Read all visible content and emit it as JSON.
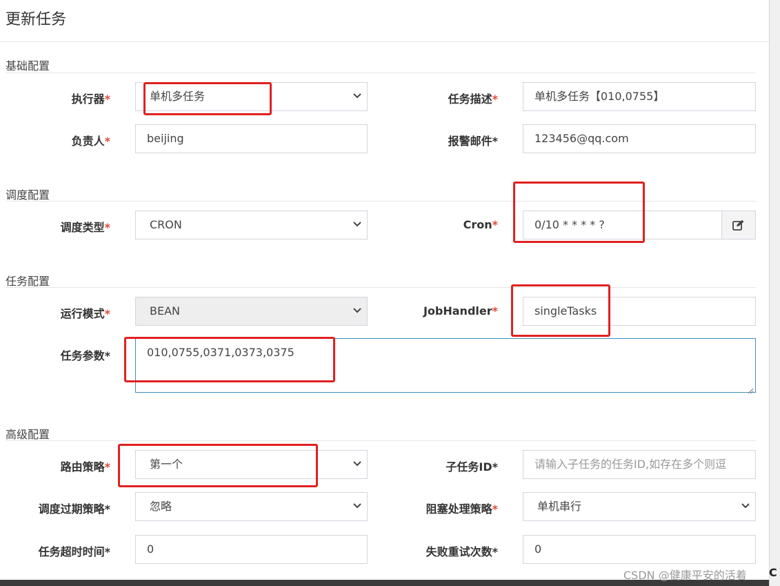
{
  "modal": {
    "title": "更新任务"
  },
  "sections": {
    "basic": "基础配置",
    "schedule": "调度配置",
    "task": "任务配置",
    "advanced": "高级配置"
  },
  "fields": {
    "executor": {
      "label": "执行器",
      "required_mark": "*",
      "value": "单机多任务"
    },
    "job_desc": {
      "label": "任务描述",
      "required_mark": "*",
      "value": "单机多任务【010,0755】"
    },
    "author": {
      "label": "负责人",
      "required_mark": "*",
      "value": "beijing"
    },
    "alarm_email": {
      "label": "报警邮件",
      "required_mark": "*",
      "value": "123456@qq.com"
    },
    "schedule_type": {
      "label": "调度类型",
      "required_mark": "*",
      "value": "CRON"
    },
    "cron": {
      "label": "Cron",
      "required_mark": "*",
      "value": "0/10 * * * * ?",
      "button_icon": "edit-icon"
    },
    "glue_type": {
      "label": "运行模式",
      "required_mark": "*",
      "value": "BEAN"
    },
    "job_handler": {
      "label": "JobHandler",
      "required_mark": "*",
      "value": "singleTasks"
    },
    "job_param": {
      "label": "任务参数",
      "required_mark": "*",
      "value": "010,0755,0371,0373,0375"
    },
    "route_strategy": {
      "label": "路由策略",
      "required_mark": "*",
      "value": "第一个"
    },
    "child_job_id": {
      "label": "子任务ID",
      "required_mark": "*",
      "placeholder": "请输入子任务的任务ID,如存在多个则逗"
    },
    "misfire_strategy": {
      "label": "调度过期策略",
      "required_mark": "*",
      "value": "忽略"
    },
    "block_strategy": {
      "label": "阻塞处理策略",
      "required_mark": "*",
      "value": "单机串行"
    },
    "timeout": {
      "label": "任务超时时间",
      "required_mark": "*",
      "value": "0"
    },
    "fail_retry": {
      "label": "失败重试次数",
      "required_mark": "*",
      "value": "0"
    }
  },
  "watermark": {
    "text": "CSDN @健康平安的活着",
    "edge_text": "C"
  },
  "colors": {
    "required": "#dd4b39",
    "highlight_box": "#e02020",
    "focus_border": "#3c8dbc"
  }
}
